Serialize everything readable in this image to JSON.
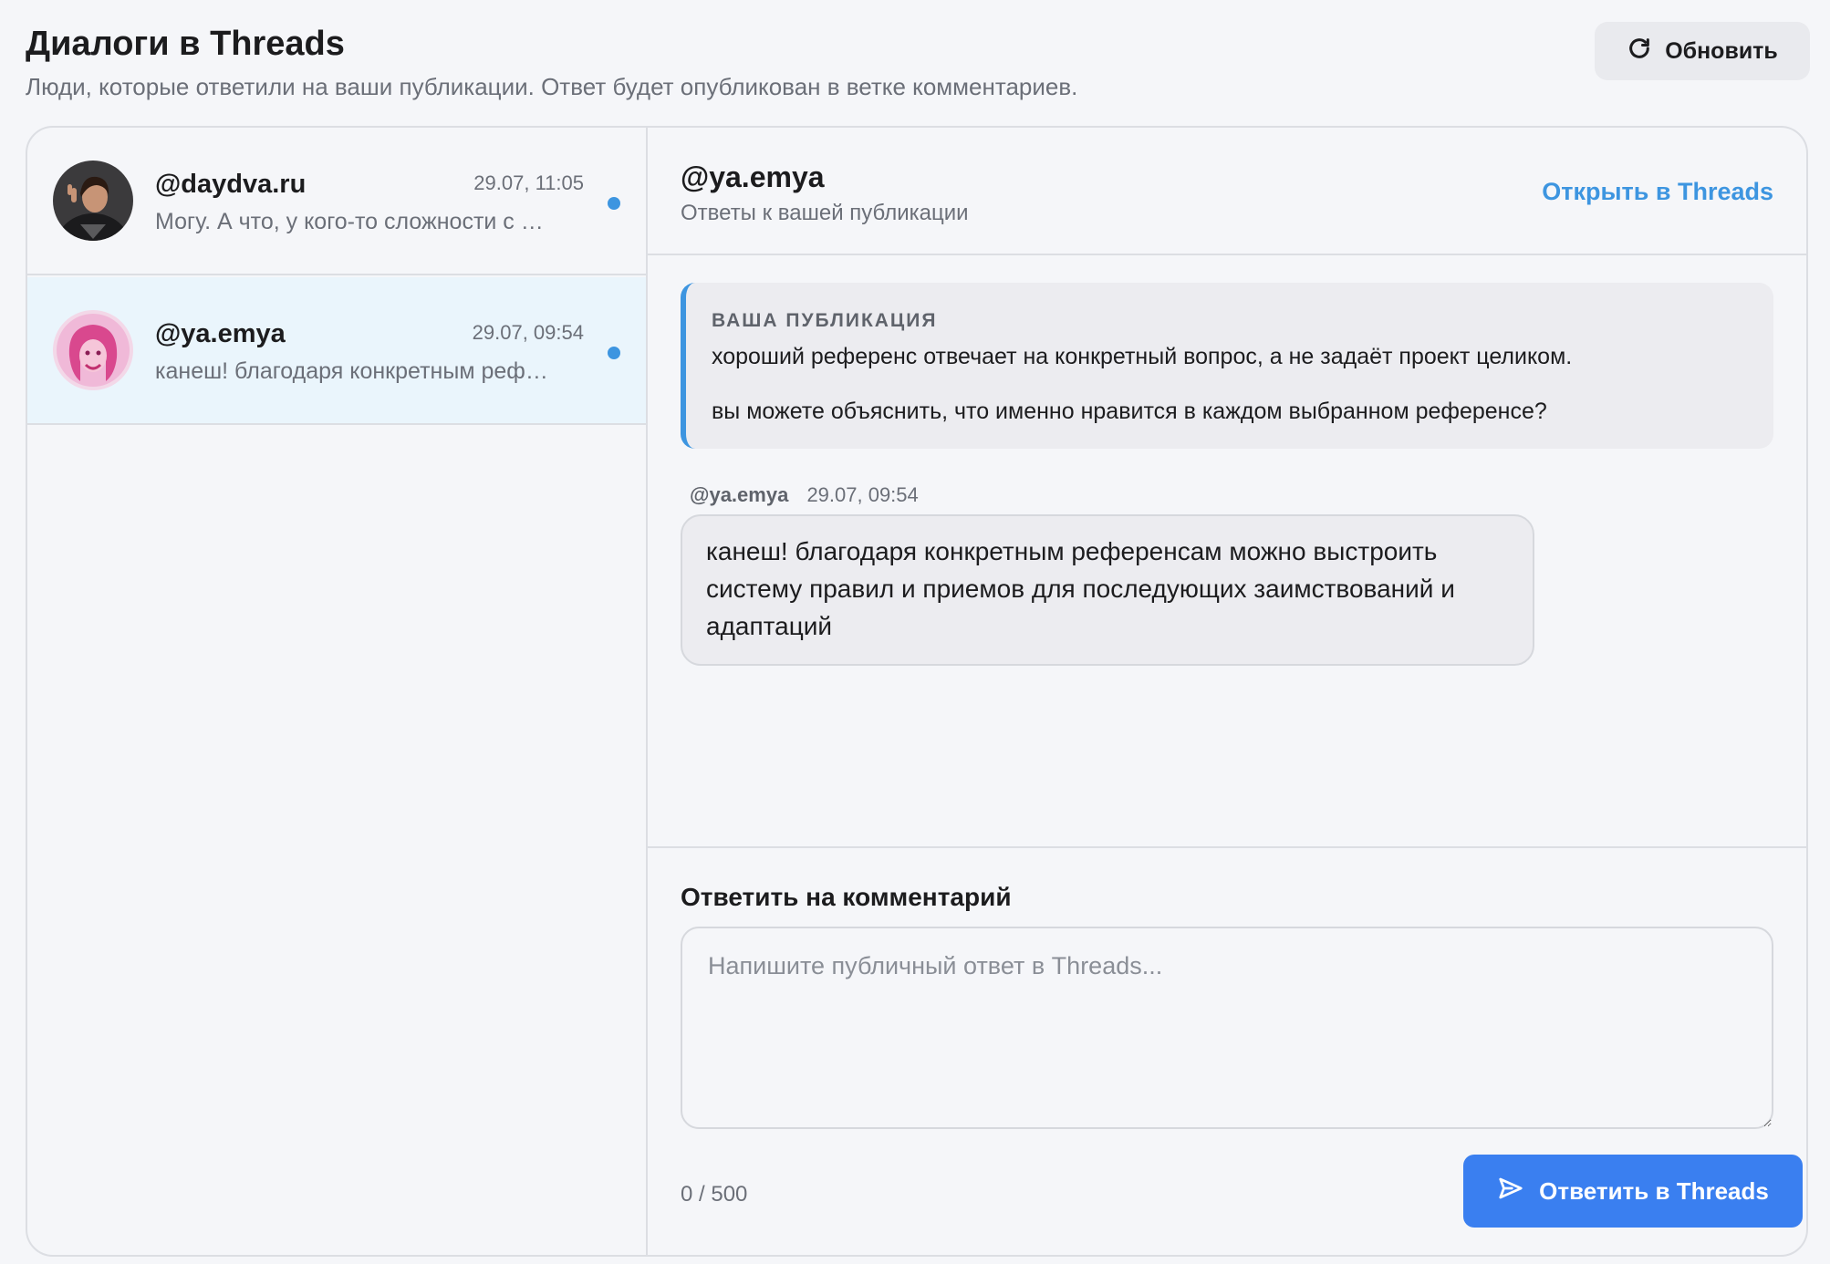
{
  "header": {
    "title": "Диалоги в Threads",
    "subtitle": "Люди, которые ответили на ваши публикации. Ответ будет опубликован в ветке комментариев.",
    "refresh_label": "Обновить",
    "refresh_icon": "refresh-icon"
  },
  "conversations": [
    {
      "username": "@daydva.ru",
      "time": "29.07, 11:05",
      "preview": "Могу. А что, у кого-то сложности с …",
      "unread": true,
      "active": false
    },
    {
      "username": "@ya.emya",
      "time": "29.07, 09:54",
      "preview": "канеш! благодаря конкретным реф…",
      "unread": true,
      "active": true
    }
  ],
  "chat": {
    "username": "@ya.emya",
    "subtitle": "Ответы к вашей публикации",
    "open_link_label": "Открыть в Threads",
    "post": {
      "label": "ВАША ПУБЛИКАЦИЯ",
      "line1": "хороший референс отвечает на конкретный вопрос, а не задаёт проект целиком.",
      "line2": "вы можете объяснить, что именно нравится в каждом выбранном референсе?"
    },
    "message": {
      "author": "@ya.emya",
      "time": "29.07, 09:54",
      "text": "канеш! благодаря конкретным референсам можно выстроить систему правил и приемов для последующих заимствований и адаптаций"
    }
  },
  "reply": {
    "title": "Ответить на комментарий",
    "placeholder": "Напишите публичный ответ в Threads...",
    "value": "",
    "counter": "0 / 500",
    "send_label": "Ответить в Threads",
    "send_icon": "send-icon"
  },
  "colors": {
    "accent": "#3d95e0",
    "button_primary": "#3a7ff0",
    "active_item_bg": "#eaf5fc",
    "background": "#f5f6f9"
  }
}
